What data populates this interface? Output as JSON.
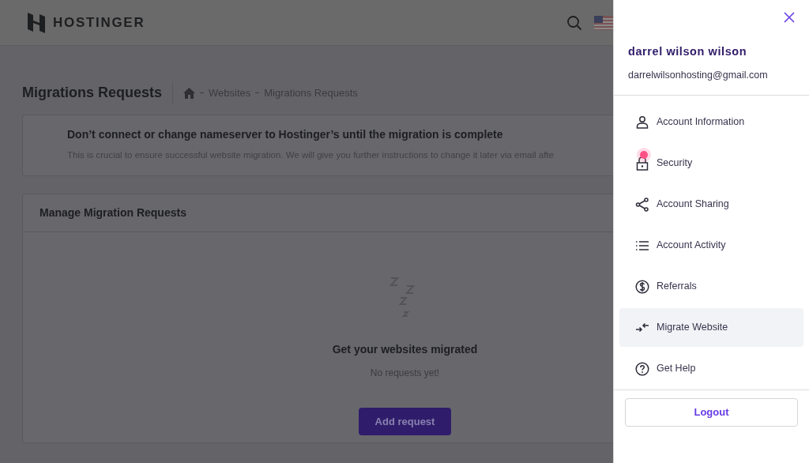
{
  "header": {
    "logo": "HOSTINGER"
  },
  "page": {
    "title": "Migrations Requests",
    "breadcrumb": [
      "Websites",
      "Migrations Requests"
    ]
  },
  "alert": {
    "title": "Don’t connect or change nameserver to Hostinger’s until the migration is complete",
    "text": "This is crucial to ensure successful website migration. We will give you further instructions to change it later via email afte"
  },
  "manage_card": {
    "title": "Manage Migration Requests",
    "empty_title": "Get your websites migrated",
    "empty_text": "No requests yet!",
    "button": "Add request"
  },
  "drawer": {
    "name": "darrel wilson wilson",
    "email": "darrelwilsonhosting@gmail.com",
    "items": [
      {
        "kind": "user",
        "label": "Account Information",
        "selected": false,
        "badge": false
      },
      {
        "kind": "lock",
        "label": "Security",
        "selected": false,
        "badge": true
      },
      {
        "kind": "share",
        "label": "Account Sharing",
        "selected": false,
        "badge": false
      },
      {
        "kind": "list",
        "label": "Account Activity",
        "selected": false,
        "badge": false
      },
      {
        "kind": "dollar",
        "label": "Referrals",
        "selected": false,
        "badge": false
      },
      {
        "kind": "migrate",
        "label": "Migrate Website",
        "selected": true,
        "badge": false
      },
      {
        "kind": "help",
        "label": "Get Help",
        "selected": false,
        "badge": false
      }
    ],
    "logout": "Logout"
  }
}
